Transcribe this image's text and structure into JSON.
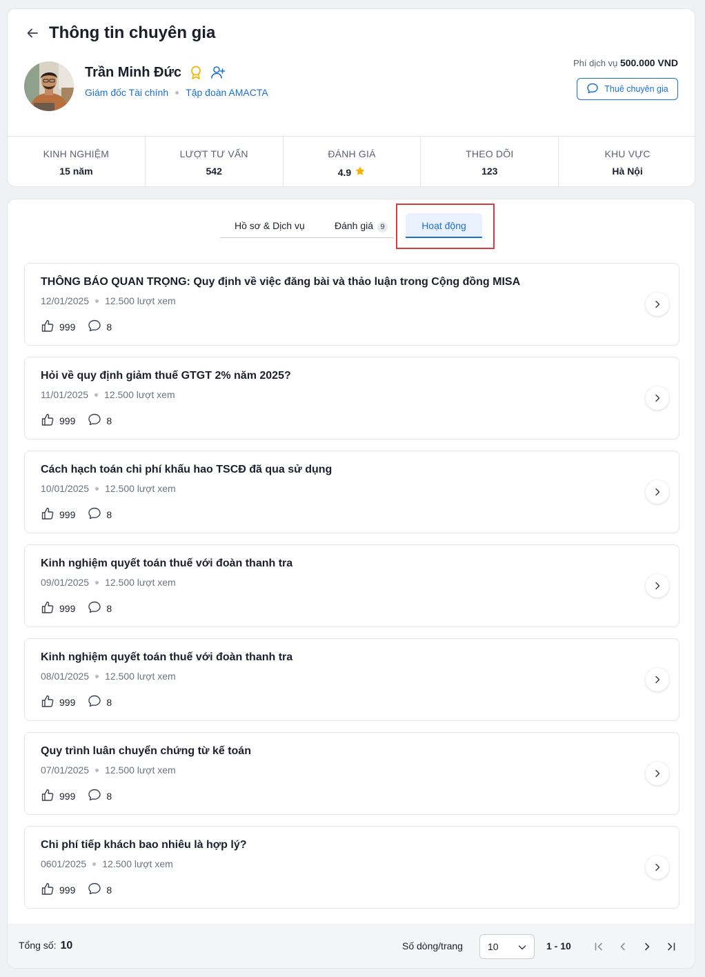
{
  "page": {
    "title": "Thông tin chuyên gia"
  },
  "expert": {
    "name": "Trần Minh Đức",
    "position": "Giám đốc Tài chính",
    "company": "Tập đoàn AMACTA",
    "fee_label": "Phí dịch vụ",
    "fee_value": "500.000 VND",
    "hire_label": "Thuê chuyên gia"
  },
  "stats": [
    {
      "label": "KINH NGHIỆM",
      "value": "15 năm"
    },
    {
      "label": "LƯỢT TƯ VẤN",
      "value": "542"
    },
    {
      "label": "ĐÁNH GIÁ",
      "value": "4.9"
    },
    {
      "label": "THEO DÕI",
      "value": "123"
    },
    {
      "label": "KHU VỰC",
      "value": "Hà Nội"
    }
  ],
  "tabs": [
    {
      "label": "Hồ sơ & Dịch vụ"
    },
    {
      "label": "Đánh giá",
      "badge": "9"
    },
    {
      "label": "Hoạt động",
      "active": true
    }
  ],
  "posts": [
    {
      "title": "THÔNG BÁO QUAN TRỌNG: Quy định về việc đăng bài và thảo luận trong Cộng đồng MISA",
      "date": "12/01/2025",
      "views": "12.500 lượt xem",
      "likes": "999",
      "comments": "8"
    },
    {
      "title": "Hỏi về quy định giảm thuế GTGT 2% năm 2025?",
      "date": "11/01/2025",
      "views": "12.500 lượt xem",
      "likes": "999",
      "comments": "8"
    },
    {
      "title": "Cách hạch toán chi phí khấu hao TSCĐ đã qua sử dụng",
      "date": "10/01/2025",
      "views": "12.500 lượt xem",
      "likes": "999",
      "comments": "8"
    },
    {
      "title": "Kinh nghiệm quyết toán thuế với đoàn thanh tra",
      "date": "09/01/2025",
      "views": "12.500 lượt xem",
      "likes": "999",
      "comments": "8"
    },
    {
      "title": "Kinh nghiệm quyết toán thuế với đoàn thanh tra",
      "date": "08/01/2025",
      "views": "12.500 lượt xem",
      "likes": "999",
      "comments": "8"
    },
    {
      "title": "Quy trình luân chuyển chứng từ kế toán",
      "date": "07/01/2025",
      "views": "12.500 lượt xem",
      "likes": "999",
      "comments": "8"
    },
    {
      "title": "Chi phí tiếp khách bao nhiêu là hợp lý?",
      "date": "0601/2025",
      "views": "12.500 lượt xem",
      "likes": "999",
      "comments": "8"
    }
  ],
  "pagination": {
    "total_label": "Tổng số:",
    "total_value": "10",
    "rows_label": "Số dòng/trang",
    "rows_value": "10",
    "range": "1 - 10"
  },
  "colors": {
    "accent": "#1a6fd6",
    "star": "#f5b400",
    "highlight": "#dc3b3b"
  },
  "icons": [
    "back-arrow-icon",
    "award-icon",
    "user-plus-icon",
    "chat-icon",
    "star-icon",
    "thumbs-up-icon",
    "comment-icon",
    "chevron-right-icon",
    "chevron-down-icon",
    "first-page-icon",
    "prev-page-icon",
    "next-page-icon",
    "last-page-icon"
  ]
}
